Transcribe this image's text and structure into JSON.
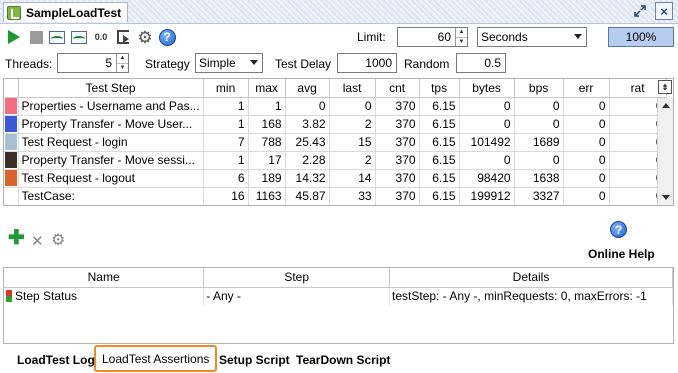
{
  "window": {
    "title": "SampleLoadTest",
    "restore_icon": "restore-icon",
    "close_icon": "close-icon",
    "close_glyph": "×"
  },
  "toolbar": {
    "icons": [
      "run-icon",
      "stop-icon",
      "statistics-graph-icon",
      "history-graph-icon",
      "reset-icon",
      "export-icon",
      "options-gear-icon",
      "help-icon"
    ],
    "reset_label": "0.0",
    "help_label": "?",
    "limit_label": "Limit:",
    "limit_value": "60",
    "limit_unit": "Seconds",
    "progress": "100%"
  },
  "settings": {
    "threads_label": "Threads:",
    "threads_value": "5",
    "strategy_label": "Strategy",
    "strategy_value": "Simple",
    "test_delay_label": "Test Delay",
    "test_delay_value": "1000",
    "random_label": "Random",
    "random_value": "0.5"
  },
  "stats": {
    "columns": [
      "Test Step",
      "min",
      "max",
      "avg",
      "last",
      "cnt",
      "tps",
      "bytes",
      "bps",
      "err",
      "rat"
    ],
    "rows": [
      {
        "color": "#f26d7d",
        "cells": [
          "Properties - Username and Pas...",
          "1",
          "1",
          "0",
          "0",
          "370",
          "6.15",
          "0",
          "0",
          "0",
          "0"
        ]
      },
      {
        "color": "#3a5bd9",
        "cells": [
          "Property Transfer - Move User...",
          "1",
          "168",
          "3.82",
          "2",
          "370",
          "6.15",
          "0",
          "0",
          "0",
          "0"
        ]
      },
      {
        "color": "#a9bfd6",
        "cells": [
          "Test Request - login",
          "7",
          "788",
          "25.43",
          "15",
          "370",
          "6.15",
          "101492",
          "1689",
          "0",
          "0"
        ]
      },
      {
        "color": "#3b2f26",
        "cells": [
          "Property Transfer - Move sessi...",
          "1",
          "17",
          "2.28",
          "2",
          "370",
          "6.15",
          "0",
          "0",
          "0",
          "0"
        ]
      },
      {
        "color": "#d9632a",
        "cells": [
          "Test Request - logout",
          "6",
          "189",
          "14.32",
          "14",
          "370",
          "6.15",
          "98420",
          "1638",
          "0",
          "0"
        ]
      },
      {
        "color": "",
        "cells": [
          "TestCase:",
          "16",
          "1163",
          "45.87",
          "33",
          "370",
          "6.15",
          "199912",
          "3327",
          "0",
          "0"
        ]
      }
    ]
  },
  "assertion_toolbar": {
    "add_glyph": "✚",
    "remove_glyph": "✕",
    "config_glyph": "⚙",
    "help_label": "?",
    "online_help": "Online Help"
  },
  "assertions": {
    "columns": [
      "Name",
      "Step",
      "Details"
    ],
    "rows": [
      {
        "cells": [
          "Step Status",
          "- Any -",
          "testStep: - Any -, minRequests: 0, maxErrors: -1"
        ]
      }
    ]
  },
  "tabs": [
    "LoadTest Log",
    "LoadTest Assertions",
    "Setup Script",
    "TearDown Script"
  ],
  "active_tab": "LoadTest Assertions",
  "colors": {
    "accent_highlight": "#f08a24",
    "progress_fill": "#b7cdf0"
  }
}
